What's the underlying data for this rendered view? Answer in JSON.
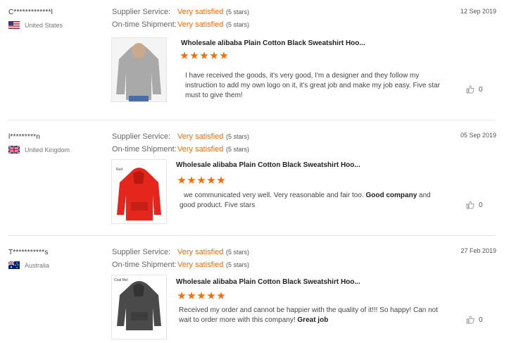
{
  "reviews": [
    {
      "user": "C*************l",
      "country": "United States",
      "flag": "us-flag",
      "supplier_label": "Supplier Service:",
      "supplier_value": "Very satisfied",
      "supplier_stars": "(5 stars)",
      "shipment_label": "On-time Shipment:",
      "shipment_value": "Very satisfied",
      "shipment_stars": "(5 stars)",
      "date": "12 Sep 2019",
      "product_title": "Wholesale alibaba Plain Cotton Black Sweatshirt Hoo...",
      "rating": 5,
      "text_1": "I have received the goods, it's very good, I'm a designer and they follow my instruction to add my own logo on it, it's great job and make my job easy. Five star must to give them!",
      "text_bold": "",
      "text_2": "",
      "likes": "0",
      "image_color": "#a9a9a9",
      "image_label": ""
    },
    {
      "user": "l*********n",
      "country": "United Kingdom",
      "flag": "uk-flag",
      "supplier_label": "Supplier Service:",
      "supplier_value": "Very satisfied",
      "supplier_stars": "(5 stars)",
      "shipment_label": "On-time Shipment:",
      "shipment_value": "Very satisfied",
      "shipment_stars": "(5 stars)",
      "date": "05 Sep 2019",
      "product_title": "Wholesale alibaba Plain Cotton Black Sweatshirt Hoo...",
      "rating": 5,
      "text_1": "we communicated very well. Very reasonable and fair too. ",
      "text_bold": "Good company",
      "text_2": " and good product. Five stars",
      "likes": "0",
      "image_color": "#e4261c",
      "image_label": "Red"
    },
    {
      "user": "T***********s",
      "country": "Australia",
      "flag": "au-flag",
      "supplier_label": "Supplier Service:",
      "supplier_value": "Very satisfied",
      "supplier_stars": "(5 stars)",
      "shipment_label": "On-time Shipment:",
      "shipment_value": "Very satisfied",
      "shipment_stars": "(5 stars)",
      "date": "27 Feb 2019",
      "product_title": "Wholesale alibaba Plain Cotton Black Sweatshirt Hoo...",
      "rating": 5,
      "text_1": "Received my order and cannot be happier with the quality of it!!! So happy! Can not wait to order more with this company! ",
      "text_bold": "Great job",
      "text_2": "",
      "likes": "0",
      "image_color": "#4a4a4a",
      "image_label": "Coal Mel"
    }
  ]
}
